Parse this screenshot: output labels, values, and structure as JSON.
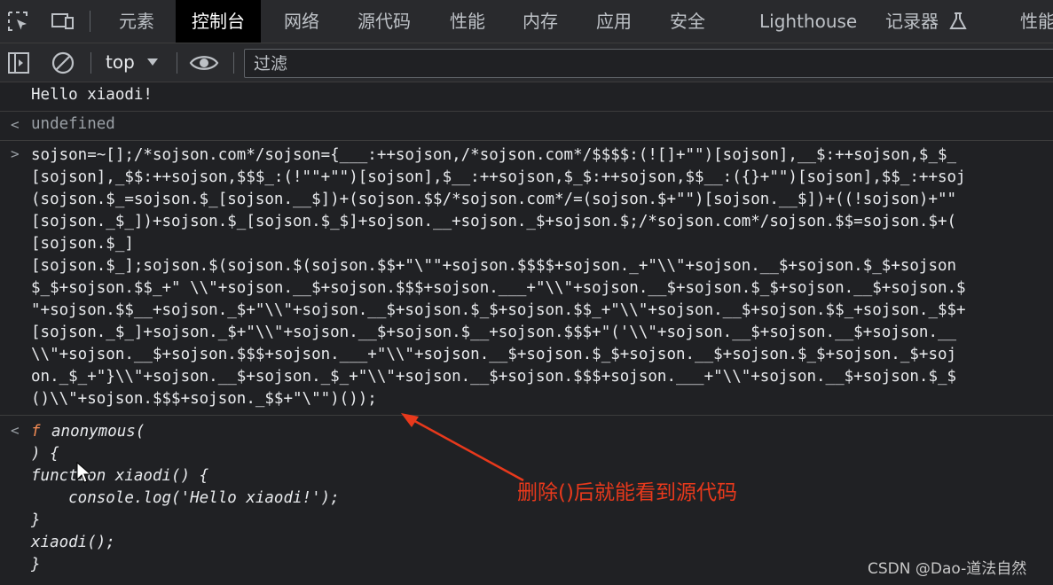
{
  "tabs": {
    "elements": "元素",
    "console": "控制台",
    "network": "网络",
    "sources": "源代码",
    "performance": "性能",
    "memory": "内存",
    "application": "应用",
    "security": "安全",
    "lighthouse": "Lighthouse",
    "recorder": "记录器",
    "perf_insights": "性能"
  },
  "toolbar": {
    "context": "top",
    "filter_placeholder": "过滤"
  },
  "console": {
    "log_output": "Hello xiaodi!",
    "undefined": "undefined",
    "input_arrow": ">",
    "output_arrow": "<",
    "input_lines": [
      "sojson=~[];/*sojson.com*/sojson={___:++sojson,/*sojson.com*/$$$$:(![]+\"\")[sojson],__$:++sojson,$_$_",
      "[sojson],_$$:++sojson,$$$_:(!\"\"+\"\")[sojson],$__:++sojson,$_$:++sojson,$$__:({}+\"\")[sojson],$$_:++soj",
      "(sojson.$_=sojson.$_[sojson.__$])+(sojson.$$/*sojson.com*/=(sojson.$+\"\")[sojson.__$])+((!sojson)+\"\"",
      "[sojson._$_])+sojson.$_[sojson.$_$]+sojson.__+sojson._$+sojson.$;/*sojson.com*/sojson.$$=sojson.$+(",
      "[sojson.$_]",
      "[sojson.$_];sojson.$(sojson.$(sojson.$$+\"\\\"\"+sojson.$$$$+sojson._+\"\\\\\"+sojson.__$+sojson.$_$+sojson",
      "$_$+sojson.$$_+\" \\\\\"+sojson.__$+sojson.$$$+sojson.___+\"\\\\\"+sojson.__$+sojson.$_$+sojson.__$+sojson.$",
      "\"+sojson.$$__+sojson._$+\"\\\\\"+sojson.__$+sojson.$_$+sojson.$$_+\"\\\\\"+sojson.__$+sojson.$$_+sojson._$$+",
      "[sojson._$_]+sojson._$+\"\\\\\"+sojson.__$+sojson.$__+sojson.$$$+\"('\\\\\"+sojson.__$+sojson.__$+sojson.__",
      "\\\\\"+sojson.__$+sojson.$$$+sojson.___+\"\\\\\"+sojson.__$+sojson.$_$+sojson.__$+sojson.$_$+sojson._$+soj",
      "on._$_+\"}\\\\\"+sojson.__$+sojson._$_+\"\\\\\"+sojson.__$+sojson.$$$+sojson.___+\"\\\\\"+sojson.__$+sojson.$_$",
      "()\\\\\"+sojson.$$$+sojson._$$+\"\\\"\")());"
    ],
    "result_lines": [
      "anonymous(",
      ") {",
      "function xiaodi() {",
      "    console.log('Hello xiaodi!');",
      "}",
      "xiaodi();",
      "}"
    ],
    "result_f": "f"
  },
  "annotation": "删除()后就能看到源代码",
  "watermark": "CSDN @Dao-道法自然",
  "colors": {
    "background": "#202124",
    "string": "#f28b54",
    "property": "#e6c07b",
    "annotation": "#e8391c"
  }
}
